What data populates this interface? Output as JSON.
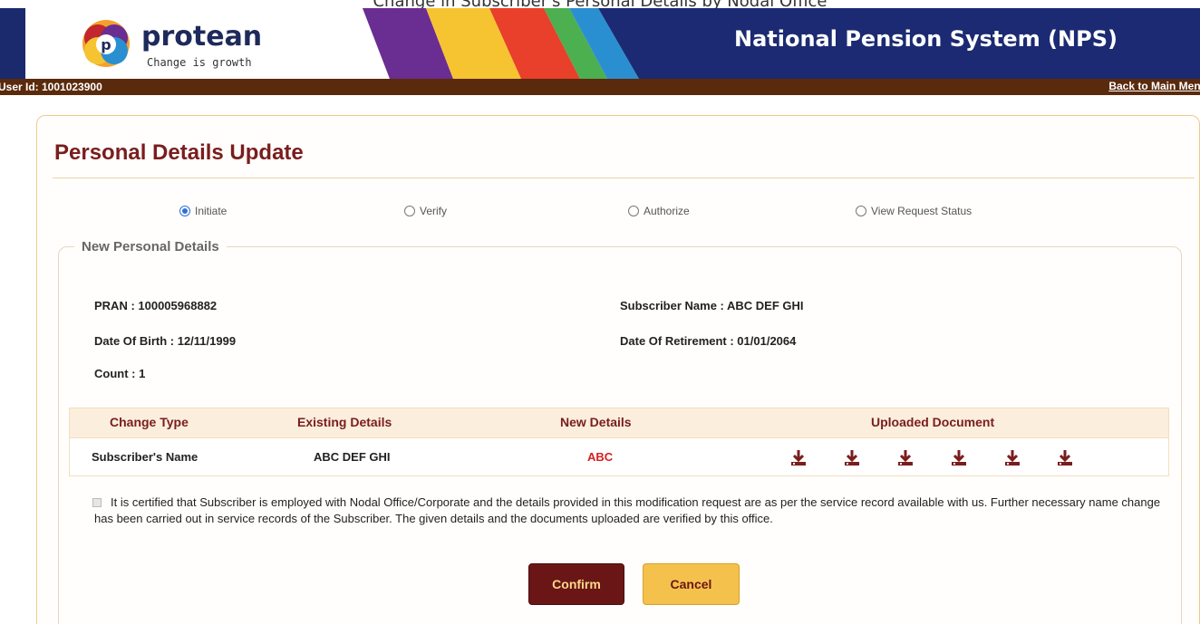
{
  "caption": "Change in Subscriber's Personal Details by Nodal Office",
  "header": {
    "logo_name": "protean",
    "logo_tagline": "Change is growth",
    "title": "National Pension System (NPS)"
  },
  "userbar": {
    "user_id": "User Id: 1001023900",
    "back_link": "Back to Main Menu"
  },
  "page": {
    "title": "Personal Details Update",
    "radios": [
      {
        "label": "Initiate",
        "checked": true
      },
      {
        "label": "Verify",
        "checked": false
      },
      {
        "label": "Authorize",
        "checked": false
      },
      {
        "label": "View Request Status",
        "checked": false
      }
    ],
    "section_legend": "New Personal Details",
    "pran": "PRAN : 100005968882",
    "subscriber_name": "Subscriber Name : ABC DEF GHI",
    "dob": "Date Of Birth : 12/11/1999",
    "dor": "Date Of Retirement : 01/01/2064",
    "count": "Count : 1"
  },
  "table": {
    "headers": [
      "Change Type",
      "Existing Details",
      "New Details",
      "Uploaded Document"
    ],
    "rows": [
      {
        "change_type": "Subscriber's Name",
        "existing": "ABC DEF GHI",
        "new": "ABC",
        "documents": 6
      }
    ]
  },
  "certification": "It is certified that Subscriber is employed with Nodal Office/Corporate and the details provided in this modification request are as per the service record available with us. Further necessary name change has been carried out in service records of the Subscriber. The given details and the documents uploaded are verified by this office.",
  "buttons": {
    "confirm": "Confirm",
    "cancel": "Cancel"
  },
  "colors": {
    "maroon": "#7a1d1d",
    "header_blue": "#1b2a72",
    "userbar_brown": "#5a2a0c",
    "cancel_yellow": "#f4c24c",
    "new_value_red": "#d42020",
    "radio_blue": "#2f6fd8"
  }
}
